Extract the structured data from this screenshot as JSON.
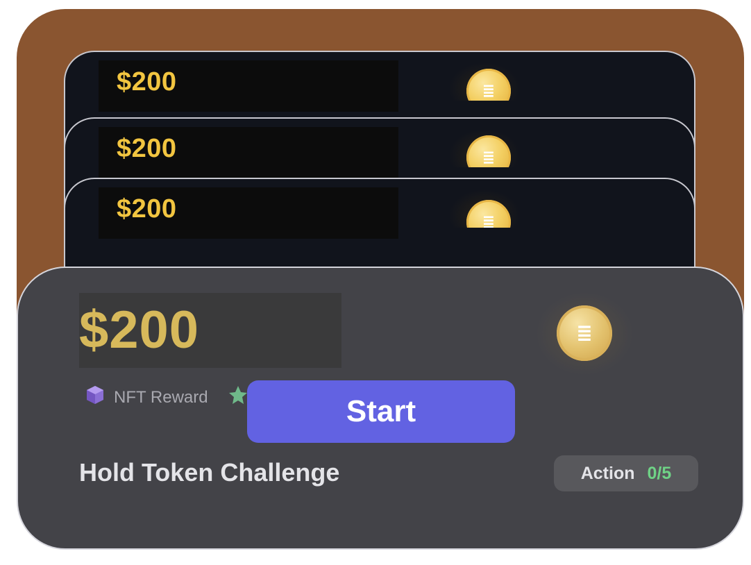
{
  "back_cards": [
    {
      "amount": "$200"
    },
    {
      "amount": "$200"
    },
    {
      "amount": "$200"
    }
  ],
  "front_card": {
    "amount": "$200",
    "nft_reward_label": "NFT Reward",
    "start_label": "Start",
    "title": "Hold Token Challenge",
    "action_label": "Action",
    "action_progress": "0/5"
  },
  "icons": {
    "coin": "coin-stack-icon",
    "nft": "cube-icon",
    "star": "star-icon"
  },
  "colors": {
    "backdrop": "#8a5530",
    "back_card": "#11141c",
    "front_card": "#434348",
    "amount_gold": "#f2c540",
    "front_amount_gold": "#d7b95b",
    "start_button": "#6262e2",
    "progress_green": "#6fd286"
  }
}
